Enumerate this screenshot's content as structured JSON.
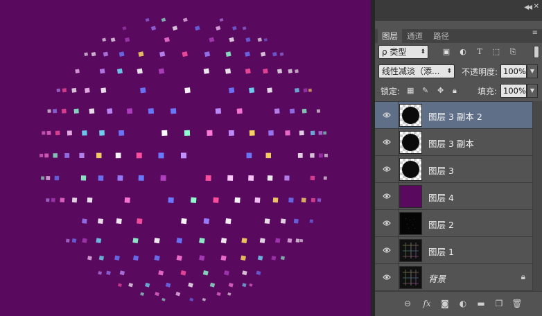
{
  "panel": {
    "tabs": [
      {
        "label": "图层",
        "active": true
      },
      {
        "label": "通道",
        "active": false
      },
      {
        "label": "路径",
        "active": false
      }
    ],
    "filter": {
      "kind_label": "ρ 类型",
      "icons": [
        "image-filter-icon",
        "adjustment-filter-icon",
        "type-filter-icon",
        "shape-filter-icon",
        "smart-object-filter-icon"
      ]
    },
    "blend_mode": "线性减淡（添...",
    "opacity_label": "不透明度:",
    "opacity_value": "100%",
    "lock_label": "锁定:",
    "fill_label": "填充:",
    "fill_value": "100%",
    "layers": [
      {
        "name": "图层 3 副本 2",
        "selected": true,
        "thumb": "sphere",
        "italic": false,
        "locked": false
      },
      {
        "name": "图层 3 副本",
        "selected": false,
        "thumb": "sphere",
        "italic": false,
        "locked": false
      },
      {
        "name": "图层 3",
        "selected": false,
        "thumb": "sphere",
        "italic": false,
        "locked": false
      },
      {
        "name": "图层 4",
        "selected": false,
        "thumb": "purple",
        "italic": false,
        "locked": false
      },
      {
        "name": "图层 2",
        "selected": false,
        "thumb": "dark",
        "italic": false,
        "locked": false
      },
      {
        "name": "图层 1",
        "selected": false,
        "thumb": "grid",
        "italic": false,
        "locked": false
      },
      {
        "name": "背景",
        "selected": false,
        "thumb": "grid",
        "italic": true,
        "locked": true
      }
    ],
    "bottom_icons": [
      "link-layers-icon",
      "fx-icon",
      "add-mask-icon",
      "adjustment-layer-icon",
      "new-group-icon",
      "new-layer-icon",
      "delete-layer-icon"
    ]
  },
  "colors": {
    "canvas_background": "#5a0a5e",
    "selected_layer": "#5f6f88",
    "panel_background": "#535353"
  }
}
